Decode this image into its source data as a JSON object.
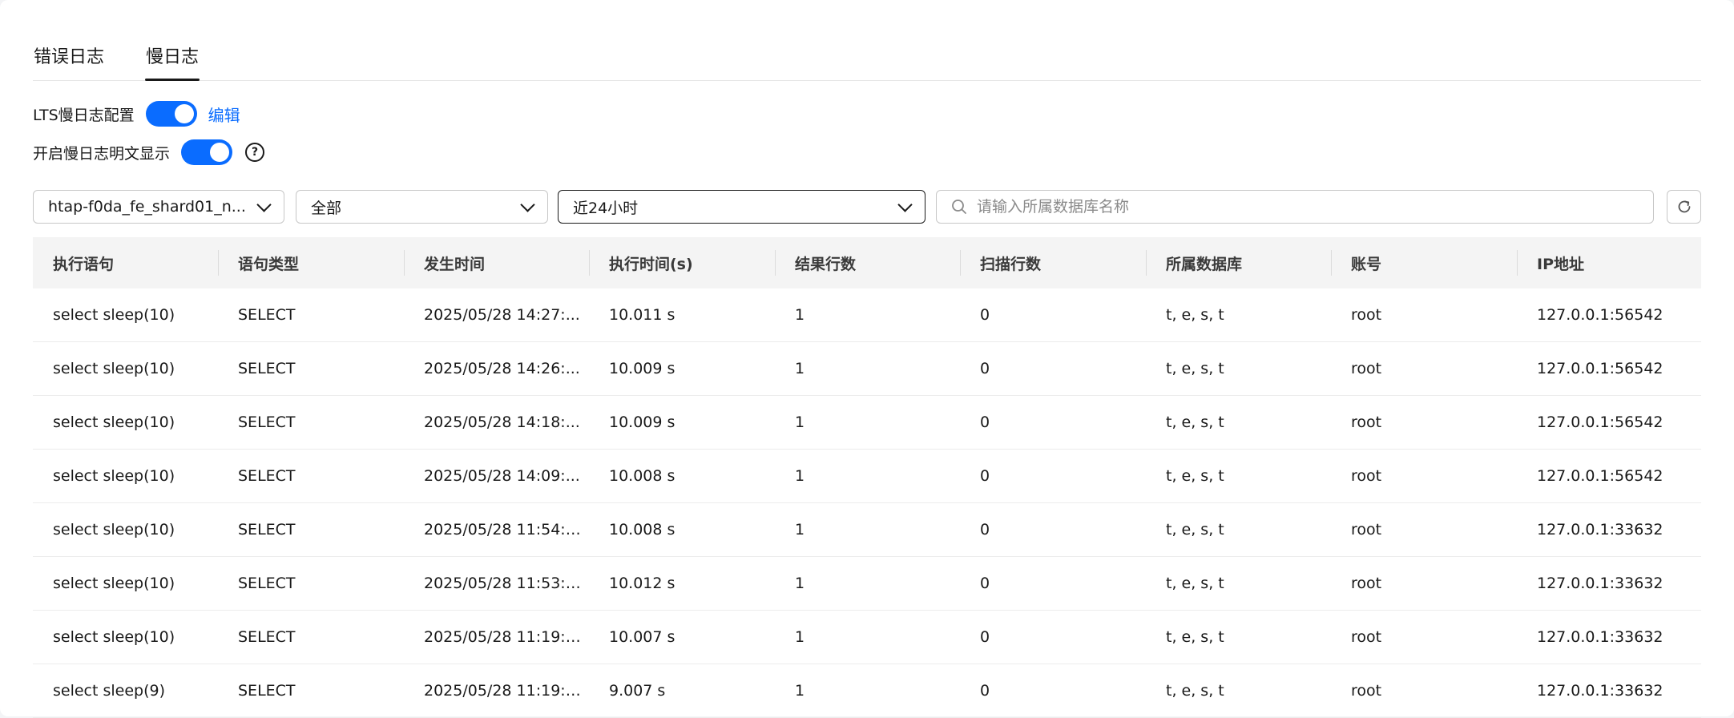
{
  "tabs": [
    {
      "label": "错误日志",
      "active": false
    },
    {
      "label": "慢日志",
      "active": true
    }
  ],
  "lts": {
    "label": "LTS慢日志配置",
    "enabled": true,
    "edit_label": "编辑"
  },
  "plaintext": {
    "label": "开启慢日志明文显示",
    "enabled": true,
    "help_symbol": "?"
  },
  "filters": {
    "node": "htap-f0da_fe_shard01_n...",
    "type": "全部",
    "time_range": "近24小时",
    "search_placeholder": "请输入所属数据库名称"
  },
  "colors": {
    "accent": "#0a6cff",
    "header_bg": "#f4f4f4"
  },
  "table": {
    "columns": [
      "执行语句",
      "语句类型",
      "发生时间",
      "执行时间(s)",
      "结果行数",
      "扫描行数",
      "所属数据库",
      "账号",
      "IP地址"
    ],
    "rows": [
      [
        "select sleep(10)",
        "SELECT",
        "2025/05/28 14:27:...",
        "10.011 s",
        "1",
        "0",
        "t, e, s, t",
        "root",
        "127.0.0.1:56542"
      ],
      [
        "select sleep(10)",
        "SELECT",
        "2025/05/28 14:26:...",
        "10.009 s",
        "1",
        "0",
        "t, e, s, t",
        "root",
        "127.0.0.1:56542"
      ],
      [
        "select sleep(10)",
        "SELECT",
        "2025/05/28 14:18:...",
        "10.009 s",
        "1",
        "0",
        "t, e, s, t",
        "root",
        "127.0.0.1:56542"
      ],
      [
        "select sleep(10)",
        "SELECT",
        "2025/05/28 14:09:...",
        "10.008 s",
        "1",
        "0",
        "t, e, s, t",
        "root",
        "127.0.0.1:56542"
      ],
      [
        "select sleep(10)",
        "SELECT",
        "2025/05/28 11:54:1...",
        "10.008 s",
        "1",
        "0",
        "t, e, s, t",
        "root",
        "127.0.0.1:33632"
      ],
      [
        "select sleep(10)",
        "SELECT",
        "2025/05/28 11:53:2...",
        "10.012 s",
        "1",
        "0",
        "t, e, s, t",
        "root",
        "127.0.0.1:33632"
      ],
      [
        "select sleep(10)",
        "SELECT",
        "2025/05/28 11:19:4...",
        "10.007 s",
        "1",
        "0",
        "t, e, s, t",
        "root",
        "127.0.0.1:33632"
      ],
      [
        "select sleep(9)",
        "SELECT",
        "2025/05/28 11:19:3...",
        "9.007 s",
        "1",
        "0",
        "t, e, s, t",
        "root",
        "127.0.0.1:33632"
      ]
    ]
  }
}
